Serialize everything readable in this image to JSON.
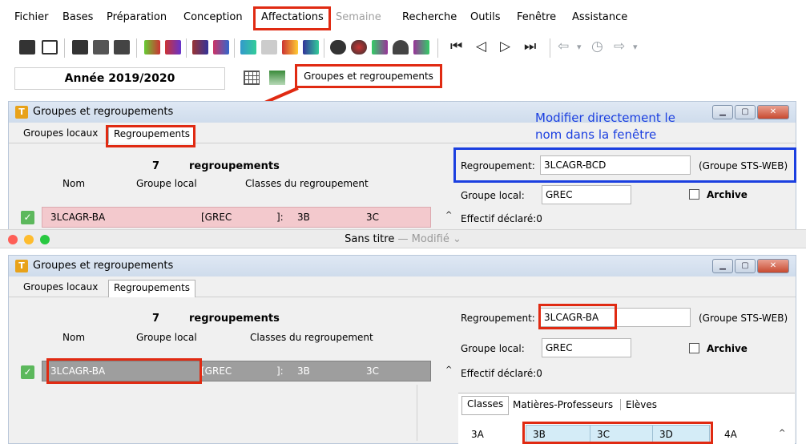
{
  "menu": [
    "Fichier",
    "Bases",
    "Préparation",
    "Conception",
    "Affectations",
    "Semaine",
    "Recherche",
    "Outils",
    "Fenêtre",
    "Assistance"
  ],
  "year_label": "Année 2019/2020",
  "groups_button": "Groupes et regroupements",
  "annotation": {
    "line1": "Modifier directement le",
    "line2": "nom dans la fenêtre"
  },
  "mac_title": "Sans titre",
  "mac_modified": "— Modifié",
  "colors": {
    "highlight_red": "#e02a12",
    "highlight_blue": "#1b3fe0",
    "row_pink": "#f3c9cd",
    "row_gray": "#9e9e9e",
    "check_green": "#5cb85c"
  },
  "win1": {
    "title": "Groupes et regroupements",
    "tabs": [
      "Groupes locaux",
      "Regroupements"
    ],
    "count": "7",
    "count_label": "regroupements",
    "col_nom": "Nom",
    "col_groupe": "Groupe local",
    "col_classes": "Classes du regroupement",
    "row": {
      "name": "3LCAGR-BA",
      "groupe": "[GREC",
      "bracket": "]:",
      "c1": "3B",
      "c2": "3C"
    },
    "regroupement_label": "Regroupement:",
    "regroupement_value": "3LCAGR-BCD",
    "sts": "(Groupe STS-WEB)",
    "groupe_local_label": "Groupe local:",
    "groupe_local_value": "GREC",
    "archive": "Archive",
    "effectif": "Effectif déclaré:0"
  },
  "win2": {
    "title": "Groupes et regroupements",
    "tabs": [
      "Groupes locaux",
      "Regroupements"
    ],
    "count": "7",
    "count_label": "regroupements",
    "col_nom": "Nom",
    "col_groupe": "Groupe local",
    "col_classes": "Classes du regroupement",
    "row": {
      "name": "3LCAGR-BA",
      "groupe": "[GREC",
      "bracket": "]:",
      "c1": "3B",
      "c2": "3C"
    },
    "regroupement_label": "Regroupement:",
    "regroupement_value": "3LCAGR-BA",
    "sts": "(Groupe STS-WEB)",
    "groupe_local_label": "Groupe local:",
    "groupe_local_value": "GREC",
    "archive": "Archive",
    "effectif": "Effectif déclaré:0",
    "subtabs": [
      "Classes",
      "Matières-Professeurs",
      "Elèves"
    ],
    "classes": [
      "3A",
      "3B",
      "3C",
      "3D",
      "4A"
    ]
  }
}
